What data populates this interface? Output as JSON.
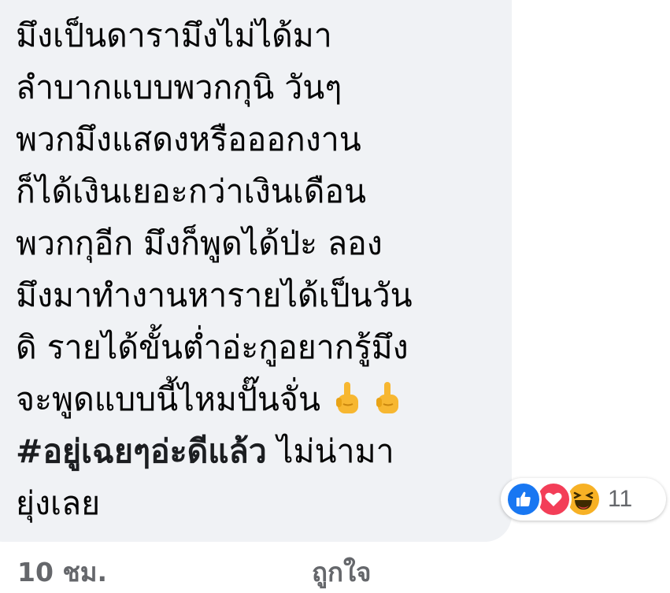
{
  "comment": {
    "lines": [
      "มึงเป็นดารามึงไม่ได้มา",
      "ลำบากแบบพวกกุนิ   วันๆ",
      "พวกมึงแสดงหรือออกงาน",
      "ก็ได้เงินเยอะกว่าเงินเดือน",
      "พวกกุอีก มึงก็พูดได้ป่ะ ลอง",
      "มึงมาทำงานหารายได้เป็นวัน",
      "ดิ รายได้ขั้นต่ำอ่ะกูอยากรู้มึง",
      "จะพูดแบบนี้ไหมปั๊นจั่น"
    ],
    "hashtag": "#อยู่เฉยๆอ่ะดีแล้ว",
    "hashtag_after": " ไม่น่ามา",
    "last_line": "ยุ่งเลย",
    "emoji_icon": "middle-finger-icon"
  },
  "reactions": {
    "icons": [
      "like-icon",
      "love-icon",
      "haha-icon"
    ],
    "count": "11",
    "colors": {
      "like": "#1877f2",
      "love": "#f33e58",
      "haha": "#f7b125"
    }
  },
  "footer": {
    "timestamp": "10 ชม.",
    "like_label": "ถูกใจ"
  }
}
